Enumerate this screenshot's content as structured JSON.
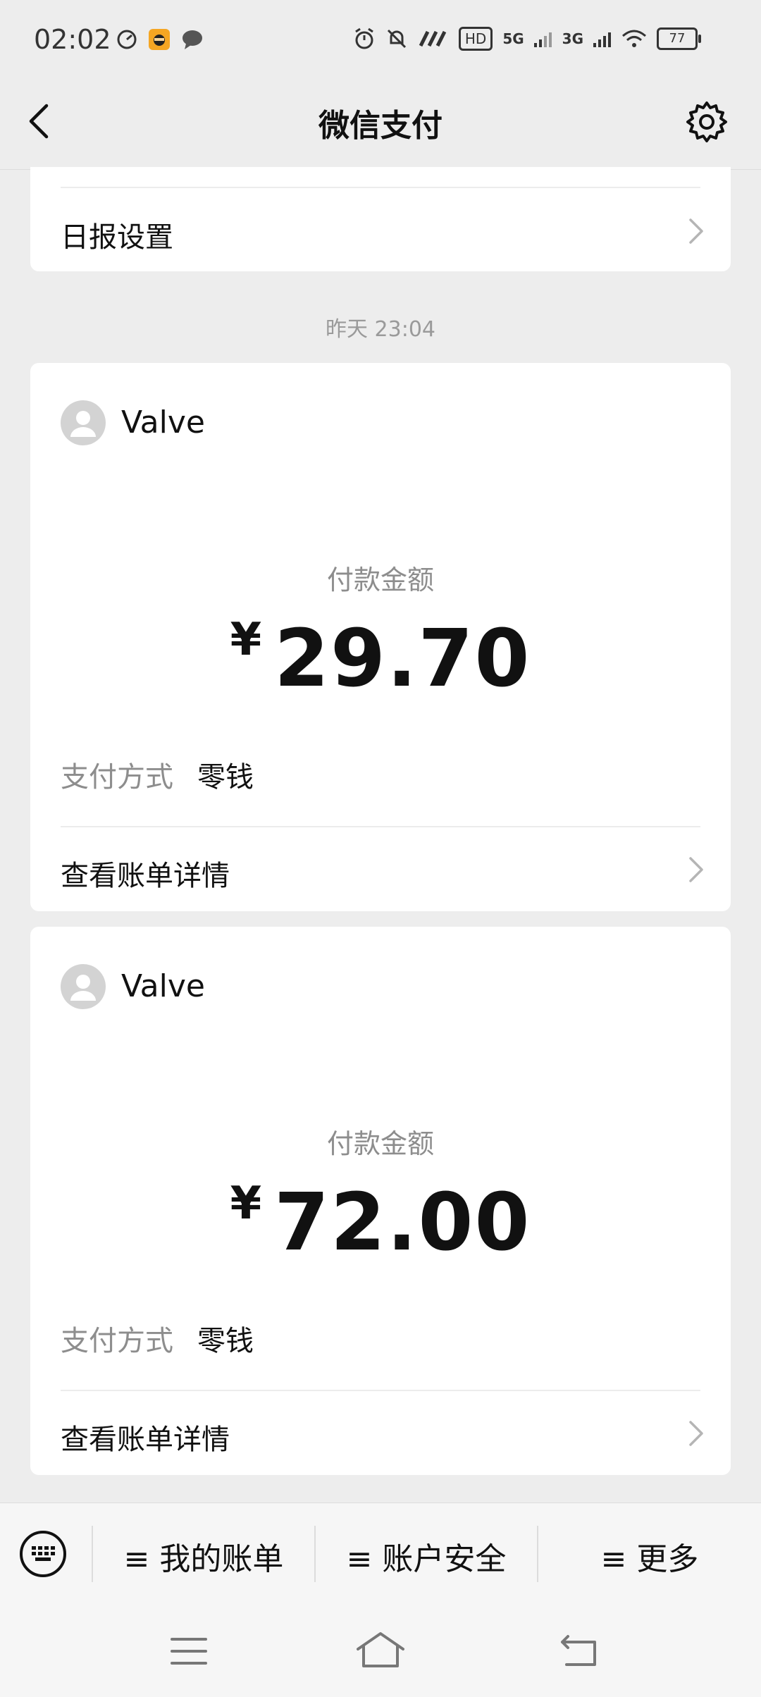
{
  "status_bar": {
    "time": "02:02",
    "signal_labels": [
      "HD",
      "5G",
      "3G"
    ],
    "battery": "77"
  },
  "header": {
    "title": "微信支付"
  },
  "top_card": {
    "label": "日报设置"
  },
  "timestamp": "昨天 23:04",
  "payments": [
    {
      "merchant": "Valve",
      "amount_label": "付款金额",
      "currency_symbol": "¥",
      "amount": "29.70",
      "method_label": "支付方式",
      "method_value": "零钱",
      "details_label": "查看账单详情"
    },
    {
      "merchant": "Valve",
      "amount_label": "付款金额",
      "currency_symbol": "¥",
      "amount": "72.00",
      "method_label": "支付方式",
      "method_value": "零钱",
      "details_label": "查看账单详情"
    }
  ],
  "bottom_menu": {
    "items": [
      "≡ 我的账单",
      "≡ 账户安全",
      "≡ 更多"
    ]
  },
  "colors": {
    "background": "#ededed",
    "card": "#ffffff",
    "secondary_text": "#8d8d8d"
  }
}
